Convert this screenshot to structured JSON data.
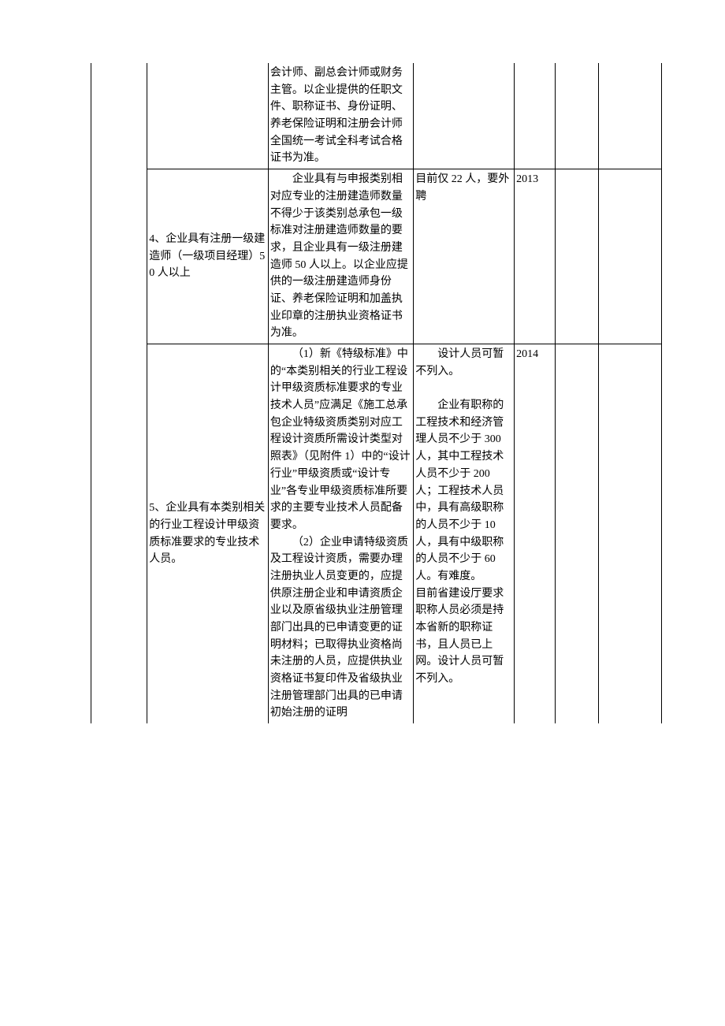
{
  "rows": [
    {
      "col1": "",
      "col2": "",
      "col3": "会计师、副总会计师或财务主管。以企业提供的任职文件、职称证书、身份证明、养老保险证明和注册会计师全国统一考试全科考试合格证书为准。",
      "col4": "",
      "col5": "",
      "col6": "",
      "col7": ""
    },
    {
      "col1": "",
      "col2": "4、企业具有注册一级建造师（一级项目经理）50 人以上",
      "col3_lead": "企业具有与申",
      "col3_rest": "报类别相对应专业的注册建造师数量不得少于该类别总承包一级标准对注册建造师数量的要求，且企业具有一级注册建造师 50 人以上。以企业应提供的一级注册建造师身份证、养老保险证明和加盖执业印章的注册执业资格证书为准。",
      "col4": "目前仅 22 人，要外聘",
      "col5": "2013",
      "col6": "",
      "col7": ""
    },
    {
      "col1": "",
      "col2": "5、企业具有本类别相关的行业工程设计甲级资质标准要求的专业技术人员。",
      "col3_p1_lead": "（1）新《特级",
      "col3_p1_rest": "标准》中的“本类别相关的行业工程设计甲级资质标准要求的专业技术人员”应满足《施工总承包企业特级资质类别对应工程设计资质所需设计类型对照表》（见附件 1）中的“设计行业”甲级资质或“设计专业”各专业甲级资质标准所要求的主要专业技术人员配备要求。",
      "col3_p2_lead": "（2）企业申",
      "col3_p2_rest": "请特级资质及工程设计资质，需要办理注册执业人员变更的，应提供原注册企业和申请资质企业以及原省级执业注册管理部门出具的已申请变更的证明材料；已取得执业资格尚未注册的人员，应提供执业资格证书复印件及省级执业注册管理部门出具的已申请初始注册的证明",
      "col4_p1": "设计人员可暂不列入。",
      "col4_p2": "企业有职称的工程技术和经济管理人员不少于 300 人，其中工程技术人员不少于 200 人；工程技术人员中，具有高级职称的人员不少于 10 人，具有中级职称的人员不少于 60 人。有难度。",
      "col4_p3": "目前省建设厅要求职称人员必须是持本省新的职称证书，且人员已上网。设计人员可暂不列入。",
      "col5": "2014",
      "col6": "",
      "col7": ""
    }
  ]
}
